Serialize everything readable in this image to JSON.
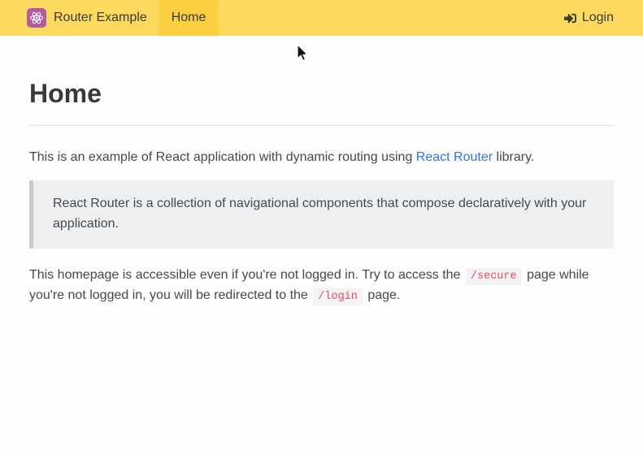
{
  "navbar": {
    "brand": {
      "label": "Router Example"
    },
    "items": [
      {
        "label": "Home",
        "active": true
      }
    ],
    "login": {
      "label": "Login"
    }
  },
  "page": {
    "title": "Home",
    "intro": {
      "before_link": "This is an example of React application with dynamic routing using ",
      "link_text": "React Router",
      "after_link": " library."
    },
    "blockquote": "React Router is a collection of navigational components that compose declaratively with your application.",
    "note": {
      "part1": "This homepage is accessible even if you're not logged in. Try to access the ",
      "code1": "/secure",
      "part2": " page while you're not logged in, you will be redirected to the ",
      "code2": "/login",
      "part3": " page."
    }
  },
  "colors": {
    "navbar_bg": "#fcd95f",
    "navbar_active_bg": "#fbcf40",
    "body_bg": "#fdfdfd",
    "link_color": "#3273dc",
    "code_color": "#f14668",
    "blockquote_bg": "#edeff0",
    "blockquote_border": "#c6cbcf",
    "brand_icon_bg": "#b45a9f"
  }
}
